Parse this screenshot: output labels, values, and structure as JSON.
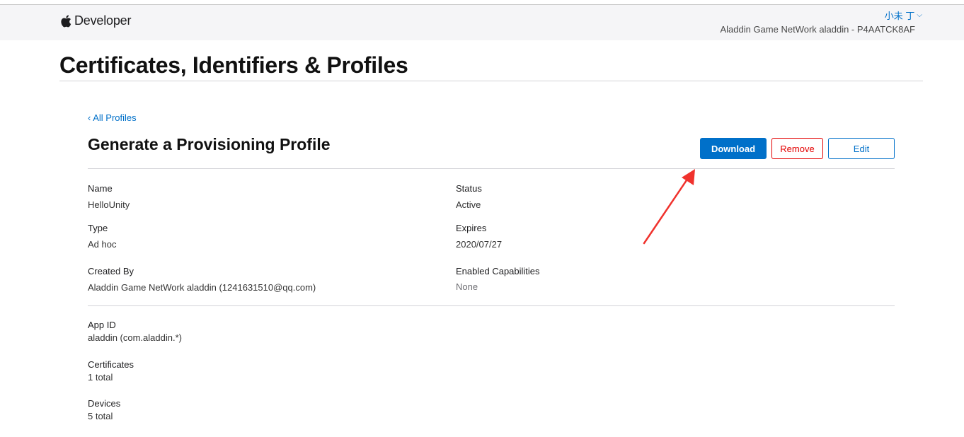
{
  "header": {
    "brand": "Developer",
    "user": "小未 丁",
    "team": "Aladdin Game NetWork aladdin - P4AATCK8AF"
  },
  "page": {
    "title": "Certificates, Identifiers & Profiles",
    "back_link": "‹ All Profiles",
    "section_title": "Generate a Provisioning Profile"
  },
  "actions": {
    "download": "Download",
    "remove": "Remove",
    "edit": "Edit"
  },
  "details": {
    "name": {
      "label": "Name",
      "value": "HelloUnity"
    },
    "status": {
      "label": "Status",
      "value": "Active"
    },
    "type": {
      "label": "Type",
      "value": "Ad hoc"
    },
    "expires": {
      "label": "Expires",
      "value": "2020/07/27"
    },
    "created_by": {
      "label": "Created By",
      "value": "Aladdin Game NetWork aladdin (1241631510@qq.com)"
    },
    "capabilities": {
      "label": "Enabled Capabilities",
      "value": "None"
    },
    "app_id": {
      "label": "App ID",
      "value": "aladdin (com.aladdin.*)"
    },
    "certificates": {
      "label": "Certificates",
      "value": "1 total"
    },
    "devices": {
      "label": "Devices",
      "value": "5 total"
    }
  },
  "colors": {
    "accent": "#0070c9",
    "danger": "#e30000",
    "annotation": "#f0322d"
  },
  "icons": {
    "brand": "apple-logo-icon",
    "user_menu": "chevron-down-icon",
    "annotation": "red-arrow-icon"
  }
}
